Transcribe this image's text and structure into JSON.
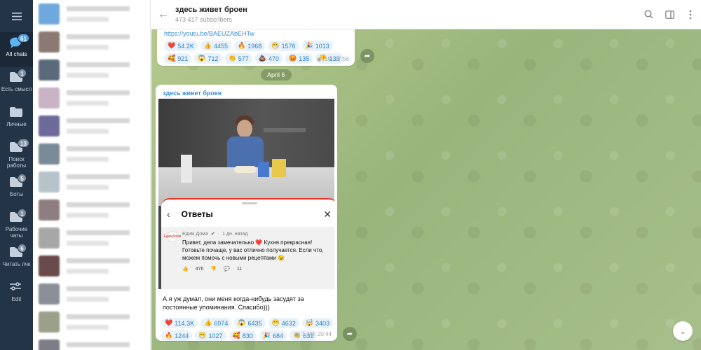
{
  "rail": {
    "folders": [
      {
        "label": "All chats",
        "badge": "61",
        "icon": "chats-icon",
        "active": true
      },
      {
        "label": "Есть смысл",
        "badge": "1",
        "icon": "folder-icon"
      },
      {
        "label": "Личные",
        "badge": "",
        "icon": "folder-icon"
      },
      {
        "label": "Поиск работы",
        "badge": "13",
        "icon": "folder-icon"
      },
      {
        "label": "Боты",
        "badge": "5",
        "icon": "folder-icon"
      },
      {
        "label": "Рабочие чаты",
        "badge": "1",
        "icon": "folder-icon"
      },
      {
        "label": "Читать лчк",
        "badge": "6",
        "icon": "folder-icon"
      },
      {
        "label": "Edit",
        "badge": "",
        "icon": "sliders-icon"
      }
    ]
  },
  "header": {
    "title": "здесь живет броен",
    "subscribers": "473 417 subscribers"
  },
  "message1": {
    "link": "https://youtu.be/BAEUZAbEHTw",
    "reactions": [
      {
        "emoji": "❤️",
        "count": "54.2K"
      },
      {
        "emoji": "👍",
        "count": "4455"
      },
      {
        "emoji": "🔥",
        "count": "1968"
      },
      {
        "emoji": "😁",
        "count": "1576"
      },
      {
        "emoji": "🎉",
        "count": "1013"
      },
      {
        "emoji": "🥰",
        "count": "921"
      },
      {
        "emoji": "😱",
        "count": "712"
      },
      {
        "emoji": "👏",
        "count": "577"
      },
      {
        "emoji": "💩",
        "count": "470"
      },
      {
        "emoji": "😡",
        "count": "135"
      },
      {
        "emoji": "👎",
        "count": "133"
      }
    ],
    "views": "1M",
    "time": "17:56"
  },
  "date_pill": "April 6",
  "message2": {
    "author": "здесь живет броен",
    "panel": {
      "title": "Ответы",
      "comment": {
        "avatar_text": "ЕдимДома",
        "author": "Едим Дома",
        "time": "1 дн. назад",
        "text": "Привет, дела замечательно ❤️ Кухня прекрасная! Готовьте почаще, у вас отлично получается. Если что, можем помочь с новыми рецептами 😉",
        "likes": "476",
        "replies": "11"
      }
    },
    "caption": "А я уж думал, они меня когда-нибудь засудят за постоянные упоминания. Спасибо)))",
    "reactions": [
      {
        "emoji": "❤️",
        "count": "114.3K"
      },
      {
        "emoji": "👍",
        "count": "6974"
      },
      {
        "emoji": "😱",
        "count": "6435"
      },
      {
        "emoji": "😁",
        "count": "4632"
      },
      {
        "emoji": "🤯",
        "count": "3403"
      },
      {
        "emoji": "🔥",
        "count": "1244"
      },
      {
        "emoji": "😁",
        "count": "1027"
      },
      {
        "emoji": "🥰",
        "count": "830"
      },
      {
        "emoji": "🎉",
        "count": "684"
      },
      {
        "emoji": "👏",
        "count": "631"
      },
      {
        "emoji": "💩",
        "count": "605"
      }
    ],
    "views": "1.1M",
    "time": "20:44"
  }
}
